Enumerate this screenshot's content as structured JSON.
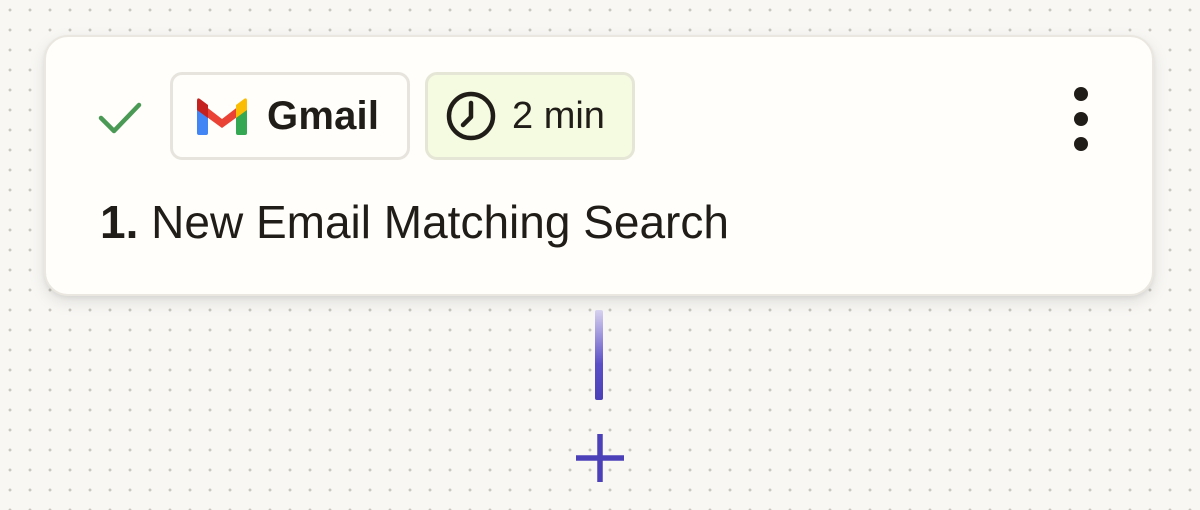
{
  "step": {
    "status_icon": "check-icon",
    "app": {
      "icon": "gmail-icon",
      "name": "Gmail"
    },
    "poll": {
      "icon": "clock-icon",
      "label": "2 min"
    },
    "menu_icon": "more-vertical-icon",
    "number": "1.",
    "title": "New Email Matching Search"
  },
  "add_step_icon": "plus-icon",
  "colors": {
    "check": "#4a9a55",
    "accent": "#4b40b8",
    "card_bg": "#fffefa",
    "time_chip_bg": "#f5fbe1",
    "canvas_bg": "#f8f7f4"
  }
}
